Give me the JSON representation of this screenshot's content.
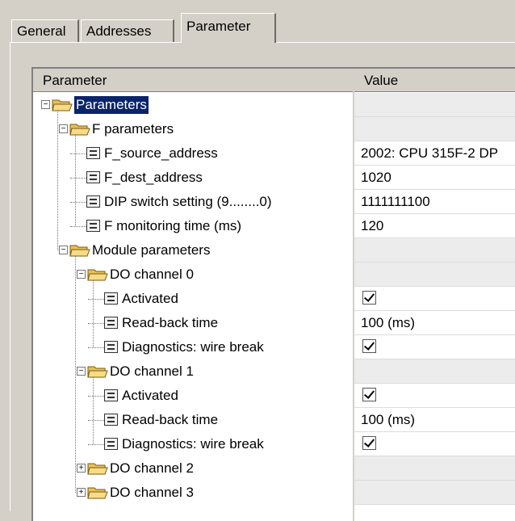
{
  "tabs": [
    {
      "label": "General"
    },
    {
      "label": "Addresses"
    },
    {
      "label": "Parameter"
    }
  ],
  "grid": {
    "header": {
      "parameter": "Parameter",
      "value": "Value"
    },
    "rows": [
      {
        "label": "Parameters",
        "value": ""
      },
      {
        "label": "F parameters",
        "value": ""
      },
      {
        "label": "F_source_address",
        "value": "2002: CPU 315F-2 DP"
      },
      {
        "label": "F_dest_address",
        "value": "1020"
      },
      {
        "label": "DIP switch setting (9........0)",
        "value": "1111111100"
      },
      {
        "label": "F monitoring time (ms)",
        "value": "120"
      },
      {
        "label": "Module parameters",
        "value": ""
      },
      {
        "label": "DO channel 0",
        "value": ""
      },
      {
        "label": "Activated",
        "value": "checked"
      },
      {
        "label": "Read-back time",
        "value": "100 (ms)"
      },
      {
        "label": "Diagnostics: wire break",
        "value": "checked"
      },
      {
        "label": "DO channel 1",
        "value": ""
      },
      {
        "label": "Activated",
        "value": "checked"
      },
      {
        "label": "Read-back time",
        "value": "100 (ms)"
      },
      {
        "label": "Diagnostics: wire break",
        "value": "checked"
      },
      {
        "label": "DO channel 2",
        "value": ""
      },
      {
        "label": "DO channel 3",
        "value": ""
      }
    ]
  },
  "icons": {
    "folder": "folder-icon",
    "parameter": "parameter-item-icon",
    "checkbox": "checkbox-checked-icon"
  },
  "colors": {
    "selection": "#0a246a",
    "window": "#d4d0c8"
  }
}
